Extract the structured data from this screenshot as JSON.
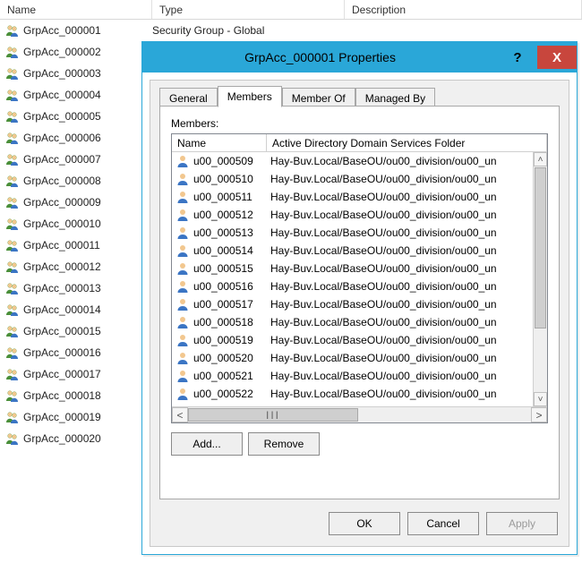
{
  "bg_headers": {
    "name": "Name",
    "type": "Type",
    "description": "Description"
  },
  "bg_type_value": "Security Group - Global",
  "bg_groups": [
    "GrpAcc_000001",
    "GrpAcc_000002",
    "GrpAcc_000003",
    "GrpAcc_000004",
    "GrpAcc_000005",
    "GrpAcc_000006",
    "GrpAcc_000007",
    "GrpAcc_000008",
    "GrpAcc_000009",
    "GrpAcc_000010",
    "GrpAcc_000011",
    "GrpAcc_000012",
    "GrpAcc_000013",
    "GrpAcc_000014",
    "GrpAcc_000015",
    "GrpAcc_000016",
    "GrpAcc_000017",
    "GrpAcc_000018",
    "GrpAcc_000019",
    "GrpAcc_000020"
  ],
  "bg_type_rows_visible": 2,
  "dialog": {
    "title": "GrpAcc_000001 Properties",
    "help_label": "?",
    "close_label": "X",
    "tabs": {
      "general": "General",
      "members": "Members",
      "memberof": "Member Of",
      "managedby": "Managed By"
    },
    "active_tab": "members",
    "members_label": "Members:",
    "list_headers": {
      "name": "Name",
      "folder": "Active Directory Domain Services Folder"
    },
    "members": [
      {
        "name": "u00_000509",
        "folder": "Hay-Buv.Local/BaseOU/ou00_division/ou00_un"
      },
      {
        "name": "u00_000510",
        "folder": "Hay-Buv.Local/BaseOU/ou00_division/ou00_un"
      },
      {
        "name": "u00_000511",
        "folder": "Hay-Buv.Local/BaseOU/ou00_division/ou00_un"
      },
      {
        "name": "u00_000512",
        "folder": "Hay-Buv.Local/BaseOU/ou00_division/ou00_un"
      },
      {
        "name": "u00_000513",
        "folder": "Hay-Buv.Local/BaseOU/ou00_division/ou00_un"
      },
      {
        "name": "u00_000514",
        "folder": "Hay-Buv.Local/BaseOU/ou00_division/ou00_un"
      },
      {
        "name": "u00_000515",
        "folder": "Hay-Buv.Local/BaseOU/ou00_division/ou00_un"
      },
      {
        "name": "u00_000516",
        "folder": "Hay-Buv.Local/BaseOU/ou00_division/ou00_un"
      },
      {
        "name": "u00_000517",
        "folder": "Hay-Buv.Local/BaseOU/ou00_division/ou00_un"
      },
      {
        "name": "u00_000518",
        "folder": "Hay-Buv.Local/BaseOU/ou00_division/ou00_un"
      },
      {
        "name": "u00_000519",
        "folder": "Hay-Buv.Local/BaseOU/ou00_division/ou00_un"
      },
      {
        "name": "u00_000520",
        "folder": "Hay-Buv.Local/BaseOU/ou00_division/ou00_un"
      },
      {
        "name": "u00_000521",
        "folder": "Hay-Buv.Local/BaseOU/ou00_division/ou00_un"
      },
      {
        "name": "u00_000522",
        "folder": "Hay-Buv.Local/BaseOU/ou00_division/ou00_un"
      }
    ],
    "buttons": {
      "add": "Add...",
      "remove": "Remove",
      "ok": "OK",
      "cancel": "Cancel",
      "apply": "Apply"
    },
    "scroll": {
      "up": "˄",
      "down": "˅",
      "left": "<",
      "right": ">",
      "grip": "III"
    }
  }
}
